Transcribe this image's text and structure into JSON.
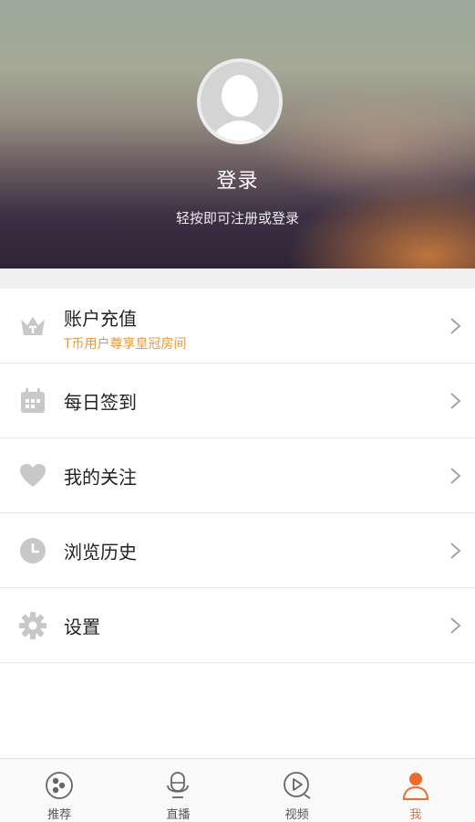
{
  "header": {
    "title": "登录",
    "subtitle": "轻按即可注册或登录"
  },
  "menu": [
    {
      "id": "recharge",
      "label": "账户充值",
      "sublabel": "T币用户尊享皇冠房间",
      "icon": "crown-icon"
    },
    {
      "id": "checkin",
      "label": "每日签到",
      "icon": "calendar-icon"
    },
    {
      "id": "follow",
      "label": "我的关注",
      "icon": "heart-icon"
    },
    {
      "id": "history",
      "label": "浏览历史",
      "icon": "clock-icon"
    },
    {
      "id": "settings",
      "label": "设置",
      "icon": "gear-icon"
    }
  ],
  "tabs": [
    {
      "label": "推荐",
      "icon": "recommend-icon",
      "active": false
    },
    {
      "label": "直播",
      "icon": "microphone-icon",
      "active": false
    },
    {
      "label": "视频",
      "icon": "video-play-icon",
      "active": false
    },
    {
      "label": "我",
      "icon": "profile-icon",
      "active": true
    }
  ],
  "colors": {
    "accent": "#f06a2c",
    "sublabel": "#e79b36",
    "icon_gray": "#c8c8c8"
  }
}
